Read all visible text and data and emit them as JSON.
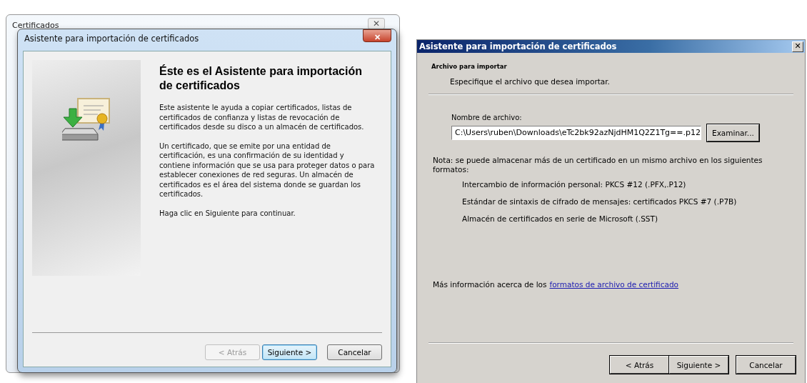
{
  "left": {
    "background_window": {
      "title": "Certificados",
      "close": "✕"
    },
    "dialog": {
      "title": "Asistente para importación de certificados",
      "close": "✕",
      "heading": "Éste es el Asistente para importación de certificados",
      "paragraphs": [
        "Este asistente le ayuda a copiar certificados, listas de certificados de confianza y listas de revocación de certificados desde su disco a un almacén de certificados.",
        "Un certificado, que se emite por una entidad de certificación, es una confirmación de su identidad y contiene información que se usa para proteger datos o para establecer conexiones de red seguras. Un almacén de certificados es el área del sistema donde se guardan los certificados.",
        "Haga clic en Siguiente para continuar."
      ],
      "buttons": [
        {
          "label": "< Atrás",
          "disabled": true,
          "default": false
        },
        {
          "label": "Siguiente >",
          "disabled": false,
          "default": true
        },
        {
          "label": "Cancelar",
          "disabled": false,
          "default": false
        }
      ]
    }
  },
  "right": {
    "dialog": {
      "title": "Asistente para importación de certificados",
      "close": "✕",
      "section_title": "Archivo para importar",
      "section_subtitle": "Especifique el archivo que desea importar.",
      "file_label": "Nombre de archivo:",
      "file_value": "C:\\Users\\ruben\\Downloads\\eTc2bk92azNjdHM1Q2Z1Tg==.p12",
      "browse_button": "Examinar...",
      "note": "Nota: se puede almacenar más de un certificado en un mismo archivo en los siguientes formatos:",
      "formats": [
        "Intercambio de información personal: PKCS #12 (.PFX,.P12)",
        "Estándar de sintaxis de cifrado de mensajes: certificados PKCS #7 (.P7B)",
        "Almacén de certificados en serie de Microsoft (.SST)"
      ],
      "more_info": "Más información acerca de los",
      "more_info_link": "formatos de archivo de certificado",
      "buttons": [
        {
          "label": "< Atrás",
          "disabled": false
        },
        {
          "label": "Siguiente >",
          "disabled": false
        },
        {
          "label": "Cancelar",
          "disabled": false
        }
      ]
    }
  }
}
